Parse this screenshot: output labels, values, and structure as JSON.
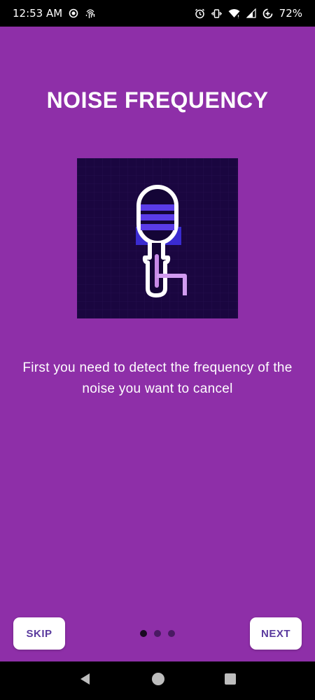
{
  "status_bar": {
    "time": "12:53 AM",
    "battery": "72%"
  },
  "screen": {
    "title": "NOISE FREQUENCY",
    "description": "First you need to detect the frequency of the noise you want to cancel",
    "skip_label": "SKIP",
    "next_label": "NEXT",
    "pager": {
      "total": 3,
      "current": 1
    }
  },
  "icons": {
    "status_left": [
      "record-icon",
      "fingerprint-icon"
    ],
    "status_right": [
      "alarm-icon",
      "vibrate-icon",
      "wifi-icon",
      "signal-icon",
      "data-saver-icon"
    ],
    "illustration": "microphone-icon",
    "nav": [
      "back-icon",
      "home-icon",
      "recents-icon"
    ]
  },
  "colors": {
    "background": "#8e2fa8",
    "illustration_bg": "#1a0640",
    "button_text": "#5a3a9e"
  }
}
